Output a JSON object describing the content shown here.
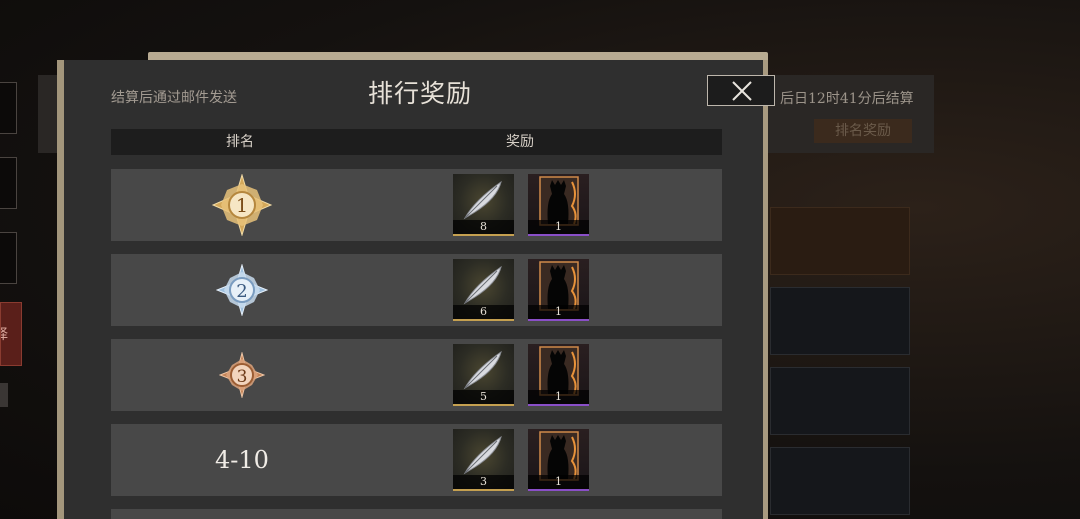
{
  "background": {
    "timer_text": "后日12时41分后结算",
    "rank_reward_button": "排名奖励",
    "select_label": "择"
  },
  "modal": {
    "note": "结算后通过邮件发送",
    "title": "排行奖励",
    "columns": {
      "rank": "排名",
      "reward": "奖励"
    },
    "rows": [
      {
        "rank": "1",
        "badge": "gold-star-badge",
        "rewards": [
          {
            "icon": "feather-icon",
            "count": "8"
          },
          {
            "icon": "character-card-icon",
            "count": "1"
          }
        ]
      },
      {
        "rank": "2",
        "badge": "silver-star-badge",
        "rewards": [
          {
            "icon": "feather-icon",
            "count": "6"
          },
          {
            "icon": "character-card-icon",
            "count": "1"
          }
        ]
      },
      {
        "rank": "3",
        "badge": "bronze-star-badge",
        "rewards": [
          {
            "icon": "feather-icon",
            "count": "5"
          },
          {
            "icon": "character-card-icon",
            "count": "1"
          }
        ]
      },
      {
        "rank": "4-10",
        "badge": "",
        "rewards": [
          {
            "icon": "feather-icon",
            "count": "3"
          },
          {
            "icon": "character-card-icon",
            "count": "1"
          }
        ]
      }
    ]
  },
  "colors": {
    "gold": "#e8c27a",
    "silver": "#b9d3ea",
    "bronze": "#d49a6f",
    "rare_purple": "#8a4fc8"
  }
}
